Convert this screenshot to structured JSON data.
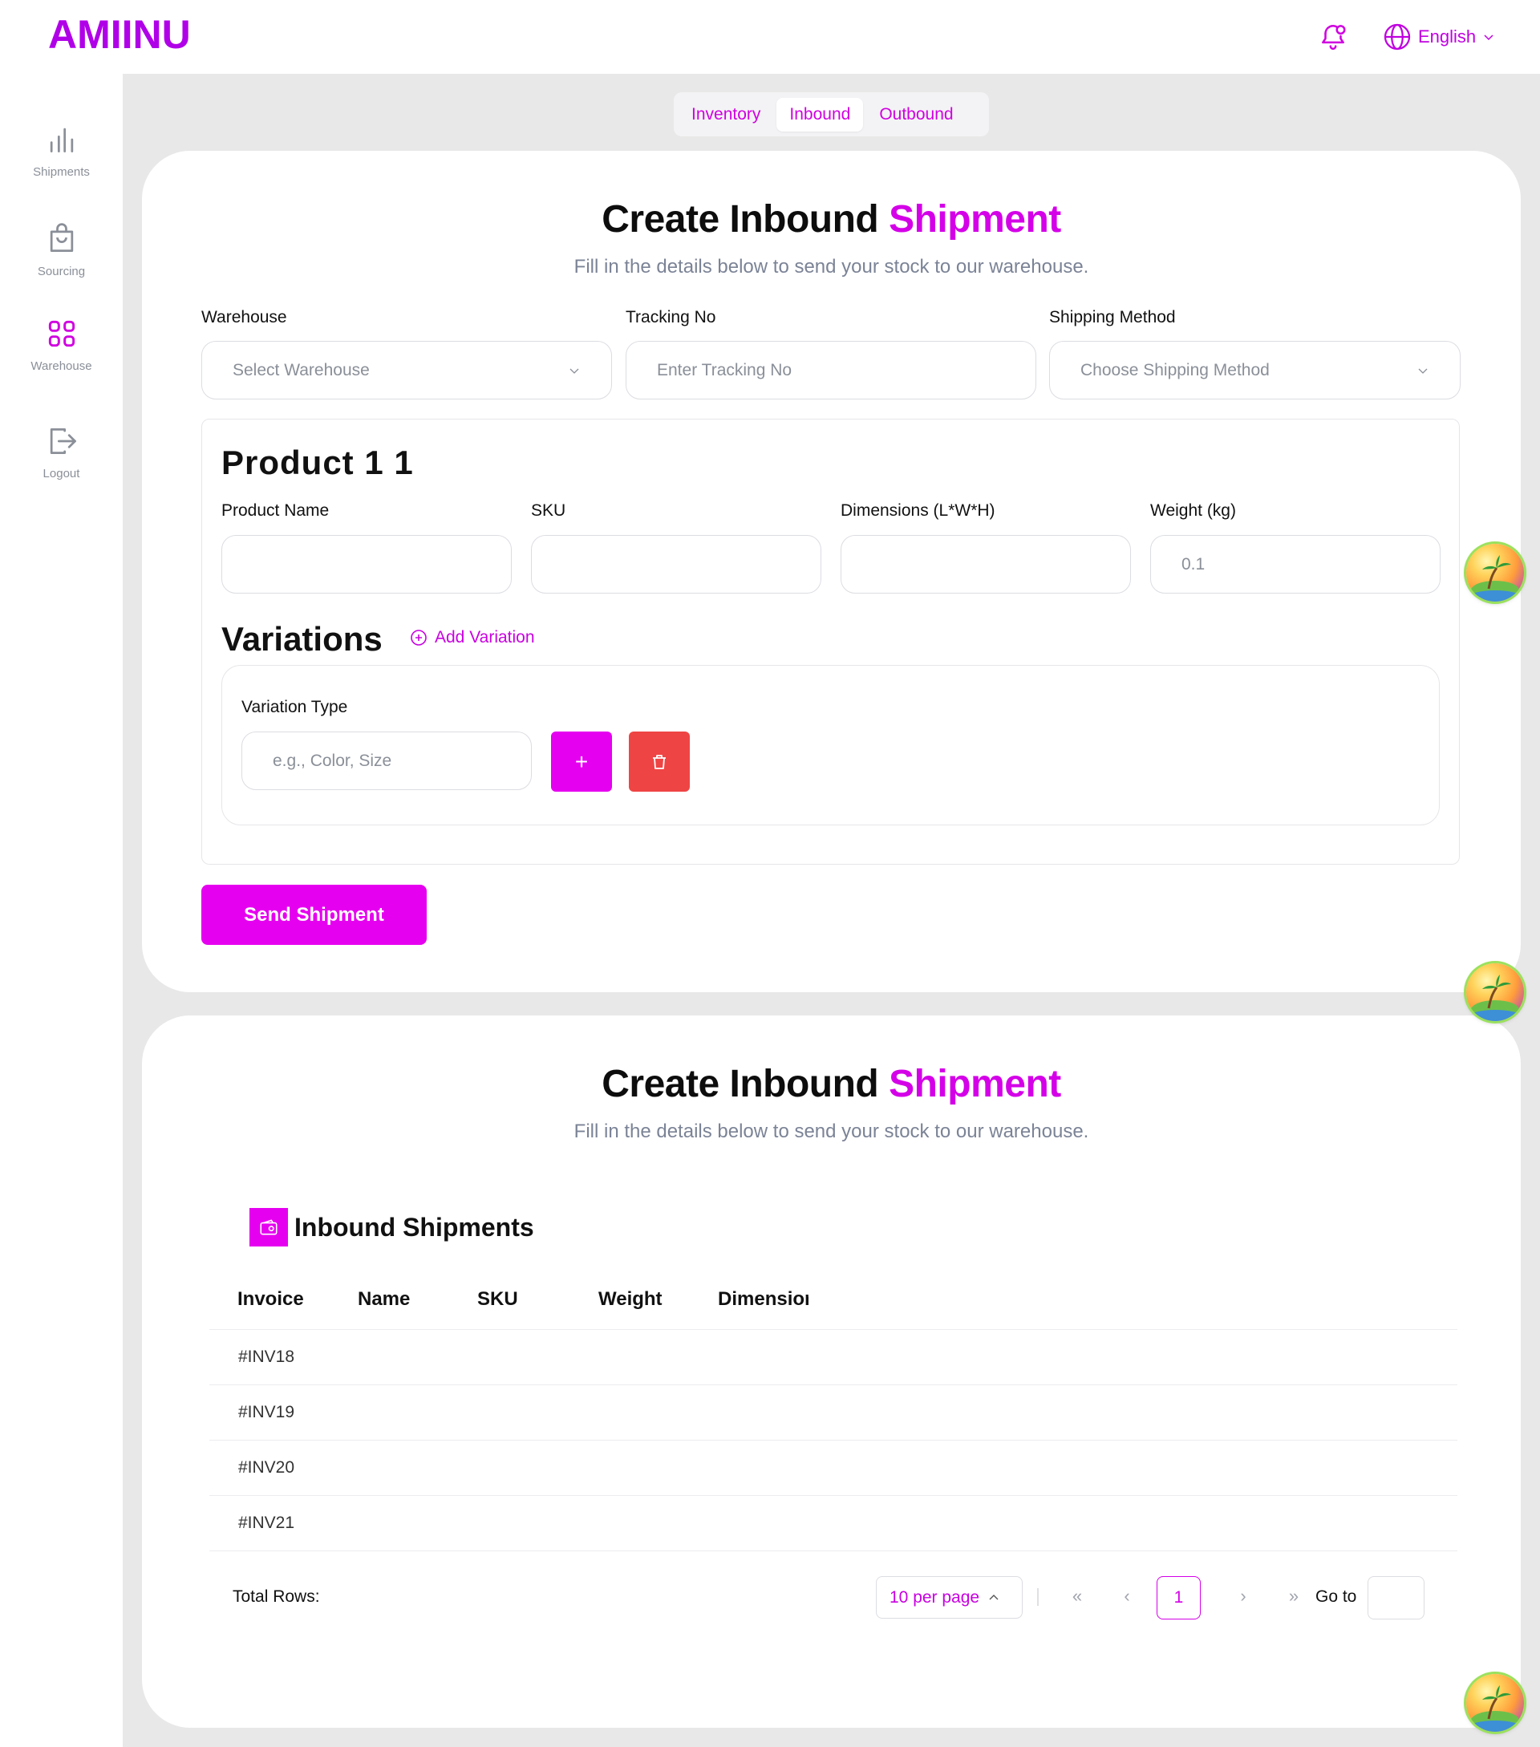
{
  "header": {
    "logo": "AMIINU",
    "language": "English"
  },
  "sidebar": {
    "items": [
      {
        "label": "Shipments",
        "icon": "bar-chart-icon"
      },
      {
        "label": "Sourcing",
        "icon": "shopping-bag-icon"
      },
      {
        "label": "Warehouse",
        "icon": "grid-icon"
      },
      {
        "label": "Logout",
        "icon": "logout-icon"
      }
    ]
  },
  "tabs": [
    "Inventory",
    "Inbound",
    "Outbound"
  ],
  "active_tab": "Inbound",
  "form": {
    "title_main": "Create Inbound",
    "title_accent": "Shipment",
    "subtitle": "Fill in the details below to send your stock to our warehouse.",
    "warehouse_label": "Warehouse",
    "warehouse_placeholder": "Select Warehouse",
    "tracking_label": "Tracking No",
    "tracking_placeholder": "Enter Tracking No",
    "shipping_label": "Shipping Method",
    "shipping_placeholder": "Choose Shipping Method",
    "product_title": "Product 1 1",
    "product_name_label": "Product Name",
    "sku_label": "SKU",
    "dimensions_label": "Dimensions (L*W*H)",
    "weight_label": "Weight (kg)",
    "weight_value": "0.1",
    "variations_title": "Variations",
    "add_variation": "Add Variation",
    "variation_type_label": "Variation Type",
    "variation_type_placeholder": "e.g., Color, Size",
    "plus_label": "+",
    "send_button": "Send Shipment"
  },
  "list": {
    "title_main": "Create Inbound",
    "title_accent": "Shipment",
    "subtitle": "Fill in the details below to send your stock to our warehouse.",
    "table_title": "Inbound Shipments",
    "columns": [
      "Invoice",
      "Name",
      "SKU",
      "Weight",
      "Dimensior"
    ],
    "rows": [
      {
        "invoice": "#INV18"
      },
      {
        "invoice": "#INV19"
      },
      {
        "invoice": "#INV20"
      },
      {
        "invoice": "#INV21"
      }
    ],
    "total_rows_label": "Total Rows:",
    "per_page": "10 per page",
    "current_page": "1",
    "goto_label": "Go to"
  },
  "colors": {
    "brand": "#b000e8",
    "accent": "#e600f0",
    "danger": "#ef4444",
    "background": "#e8e8e8"
  }
}
